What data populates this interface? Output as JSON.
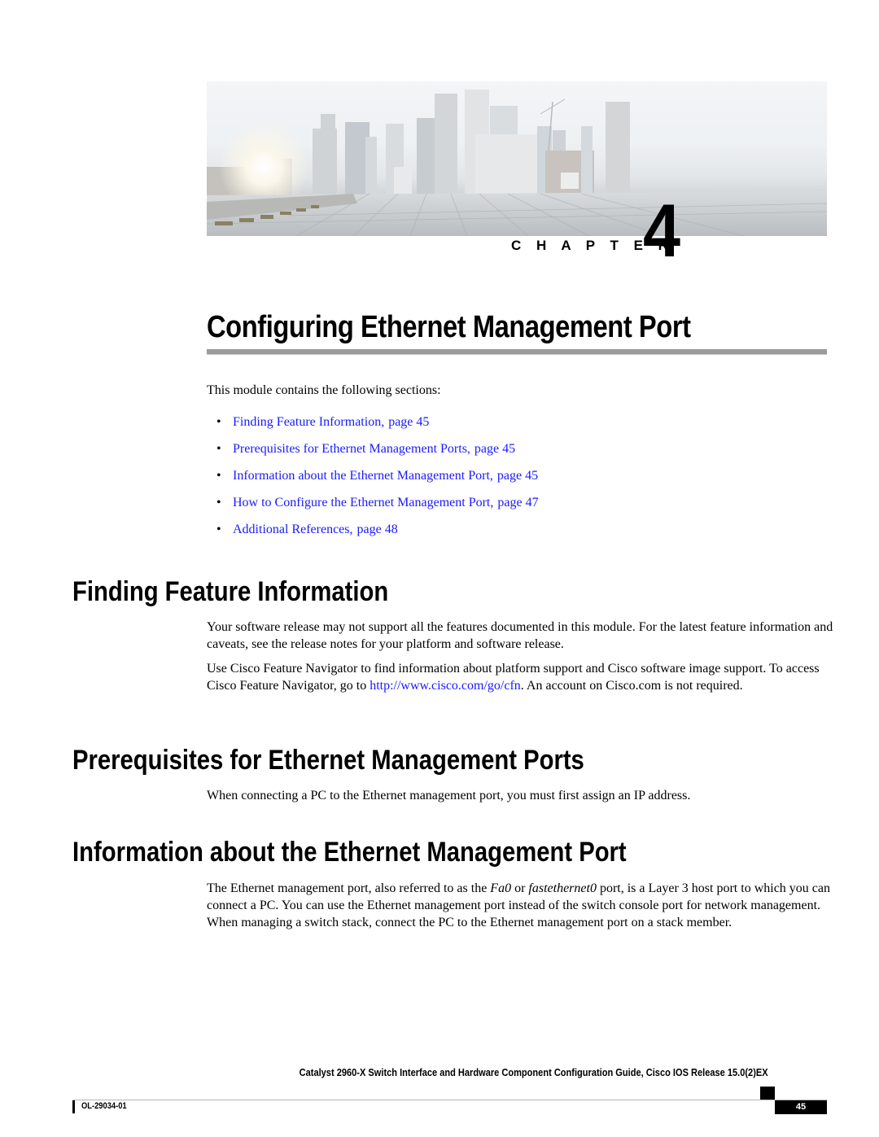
{
  "chapter": {
    "label": "C H A P T E R",
    "number": "4",
    "banner_image": "city-skyline-rooftop-solar-panels"
  },
  "title": "Configuring Ethernet Management Port",
  "intro": "This module contains the following sections:",
  "toc": [
    {
      "text": "Finding Feature Information,",
      "page": "page  45"
    },
    {
      "text": "Prerequisites for Ethernet Management Ports,",
      "page": "page  45"
    },
    {
      "text": "Information about the Ethernet Management Port,",
      "page": "page  45"
    },
    {
      "text": "How to Configure the Ethernet Management Port,",
      "page": "page  47"
    },
    {
      "text": "Additional References,",
      "page": "page  48"
    }
  ],
  "sections": [
    {
      "heading": "Finding Feature Information",
      "p1": "Your software release may not support all the features documented in this module. For the latest feature information and caveats, see the release notes for your platform and software release.",
      "p2_before": "Use Cisco Feature Navigator to find information about platform support and Cisco software image support. To access Cisco Feature Navigator, go to ",
      "p2_link": "http://www.cisco.com/go/cfn",
      "p2_after": ". An account on Cisco.com is not required."
    },
    {
      "heading": "Prerequisites for Ethernet Management Ports",
      "p1": "When connecting a PC to the Ethernet management port, you must first assign an IP address."
    },
    {
      "heading": "Information about the Ethernet Management Port",
      "p1_a": "The Ethernet management port, also referred to as the ",
      "p1_em1": "Fa0",
      "p1_b": " or ",
      "p1_em2": "fastethernet0",
      "p1_c": "  port, is a Layer 3 host port to which you can connect a PC. You can use the Ethernet management port instead of the switch console port for network management. When managing a switch stack, connect the PC to the Ethernet management port on a stack member."
    }
  ],
  "footer": {
    "guide_title": "Catalyst 2960-X Switch Interface and Hardware Component Configuration Guide, Cisco IOS Release 15.0(2)EX",
    "doc_number": "OL-29034-01",
    "page_number": "45"
  }
}
